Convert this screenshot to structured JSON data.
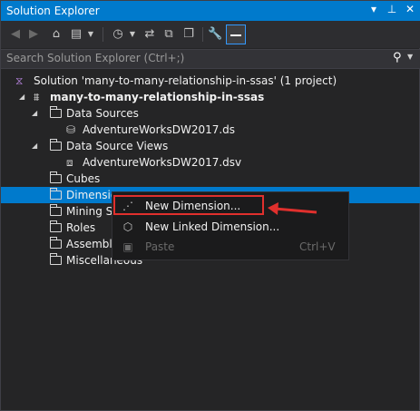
{
  "window": {
    "title": "Solution Explorer",
    "controls": {
      "dropdown": "▾",
      "pin": "⊥",
      "close": "✕"
    }
  },
  "toolbar": {
    "back_icon": "back-icon",
    "forward_icon": "forward-icon",
    "home_icon": "home-icon"
  },
  "search": {
    "placeholder": "Search Solution Explorer (Ctrl+;)",
    "value": ""
  },
  "tree": {
    "solution": "Solution 'many-to-many-relationship-in-ssas' (1 project)",
    "project": "many-to-many-relationship-in-ssas",
    "data_sources": "Data Sources",
    "data_source_file": "AdventureWorksDW2017.ds",
    "data_source_views": "Data Source Views",
    "dsv_file": "AdventureWorksDW2017.dsv",
    "cubes": "Cubes",
    "dimensions": "Dimensio",
    "mining": "Mining St",
    "roles": "Roles",
    "assemblies": "Assemblie",
    "misc": "Miscellaneous"
  },
  "context_menu": {
    "items": [
      {
        "label": "New Dimension...",
        "shortcut": "",
        "enabled": true
      },
      {
        "label": "New Linked Dimension...",
        "shortcut": "",
        "enabled": true
      },
      {
        "label": "Paste",
        "shortcut": "Ctrl+V",
        "enabled": false
      }
    ]
  },
  "colors": {
    "accent": "#007acc",
    "background": "#252526",
    "annotation": "#e0302d"
  }
}
